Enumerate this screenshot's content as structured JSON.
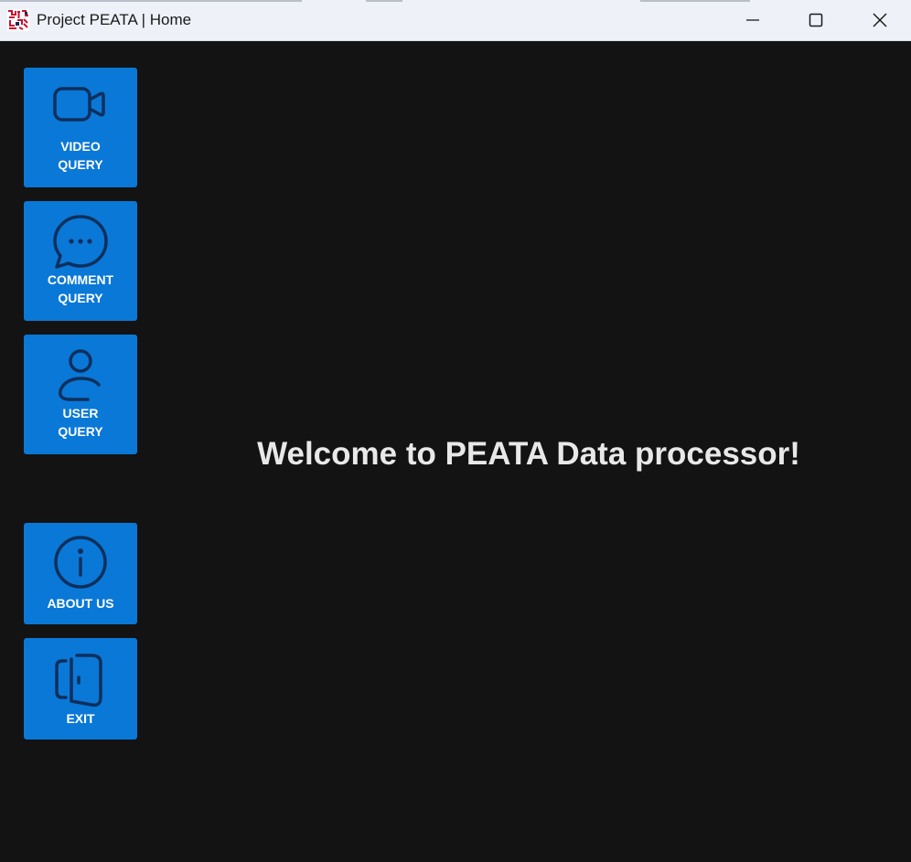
{
  "window": {
    "title": "Project PEATA | Home",
    "controls": {
      "minimize": "minimize-icon",
      "maximize": "maximize-icon",
      "close": "close-icon"
    }
  },
  "sidebar": {
    "items": [
      {
        "line1": "VIDEO",
        "line2": "QUERY",
        "icon": "video-camera-icon"
      },
      {
        "line1": "COMMENT",
        "line2": "QUERY",
        "icon": "chat-bubble-icon"
      },
      {
        "line1": "USER",
        "line2": "QUERY",
        "icon": "user-icon"
      },
      {
        "line1": "ABOUT US",
        "icon": "info-icon"
      },
      {
        "line1": "EXIT",
        "icon": "door-exit-icon"
      }
    ]
  },
  "main": {
    "welcome": "Welcome to PEATA Data processor!"
  },
  "colors": {
    "background": "#131313",
    "titlebar": "#eef2f8",
    "button": "#0a78d7",
    "icon_stroke": "#0e2f5c",
    "welcome_text": "#e8e8e8"
  }
}
